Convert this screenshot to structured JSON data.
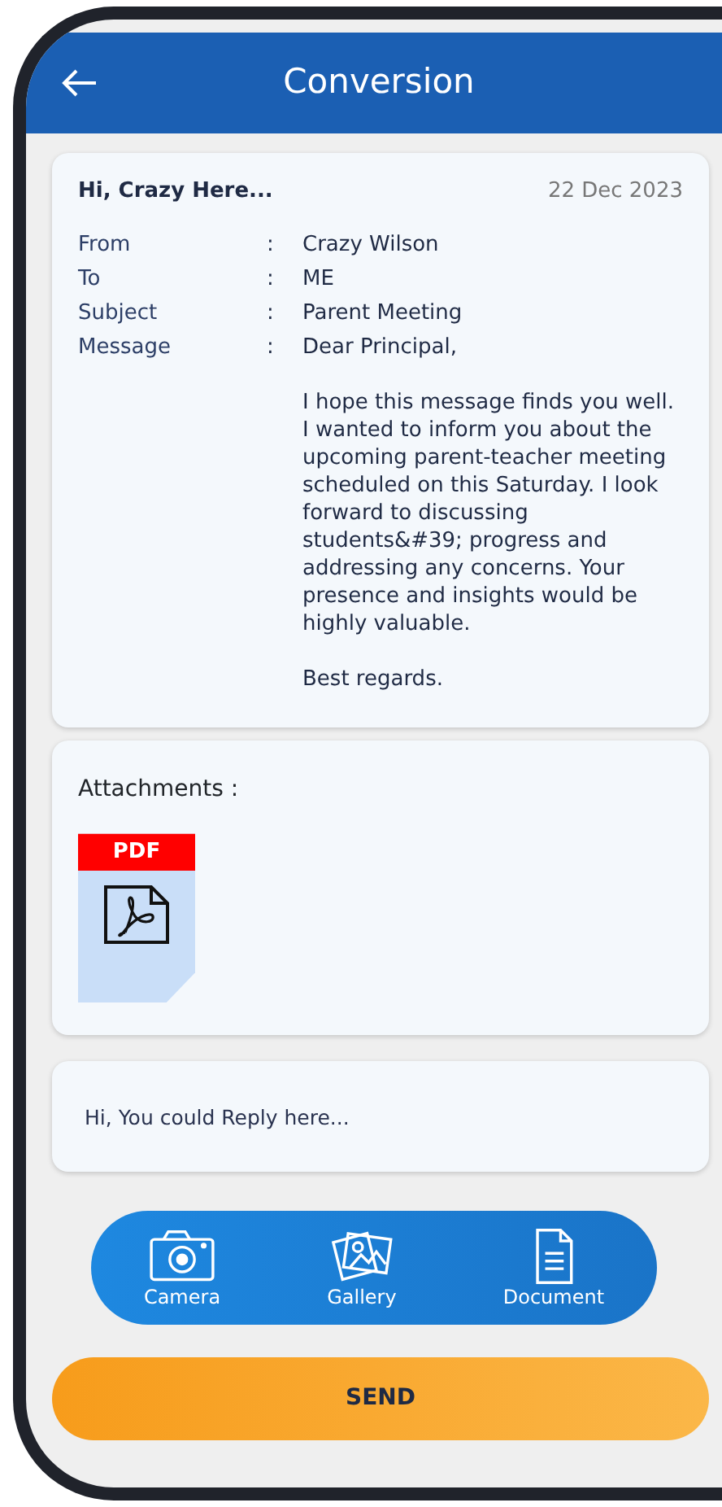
{
  "header": {
    "title": "Conversion"
  },
  "message": {
    "heading": "Hi, Crazy Here...",
    "date": "22 Dec 2023",
    "fields": [
      {
        "label": "From",
        "separator": ":",
        "paragraphs": [
          "Crazy Wilson"
        ]
      },
      {
        "label": "To",
        "separator": ":",
        "paragraphs": [
          "ME"
        ]
      },
      {
        "label": "Subject",
        "separator": ":",
        "paragraphs": [
          "Parent Meeting"
        ]
      },
      {
        "label": "Message",
        "separator": ":",
        "paragraphs": [
          "Dear Principal,",
          "I hope this message finds you well. I wanted to inform you about the upcoming parent-teacher meeting scheduled on this Saturday. I look forward to discussing students&#39; progress and addressing any concerns. Your presence and insights would be highly valuable.",
          "Best regards."
        ]
      }
    ]
  },
  "attachments": {
    "label": "Attachments :",
    "files": [
      {
        "kind": "pdf",
        "badge": "PDF"
      }
    ]
  },
  "reply": {
    "placeholder": "Hi, You could Reply here..."
  },
  "attach_actions": [
    {
      "kind": "camera",
      "label": "Camera"
    },
    {
      "kind": "gallery",
      "label": "Gallery"
    },
    {
      "kind": "document",
      "label": "Document"
    }
  ],
  "send_button": "SEND"
}
